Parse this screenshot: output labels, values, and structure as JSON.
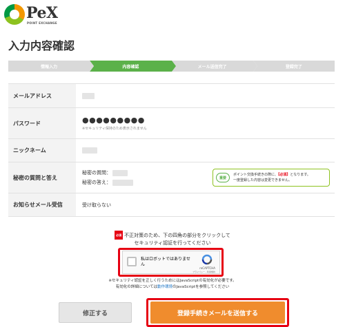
{
  "brand": {
    "logo_text": "PeX",
    "logo_sub": "POINT EXCHANGE"
  },
  "page_title": "入力内容確認",
  "steps": [
    {
      "label": "情報入力",
      "active": false
    },
    {
      "label": "内容確認",
      "active": true
    },
    {
      "label": "メール送信完了",
      "active": false
    },
    {
      "label": "登録完了",
      "active": false
    }
  ],
  "rows": {
    "email": {
      "label": "メールアドレス"
    },
    "password": {
      "label": "パスワード",
      "value": "●●●●●●●●●",
      "note": "※セキュリティ保持のため表示されません"
    },
    "nickname": {
      "label": "ニックネーム"
    },
    "secret": {
      "label": "秘密の質問と答え",
      "question_label": "秘密の質問：",
      "answer_label": "秘密の答え："
    },
    "newsletter": {
      "label": "お知らせメール受信",
      "value": "受け取らない"
    }
  },
  "notice": {
    "badge": "重要",
    "line1_pre": "ポイント交換手続きの際に、",
    "line1_req": "【必須】",
    "line1_post": "となります。",
    "line2": "一度登録した内容は変更できません。"
  },
  "security": {
    "badge": "必須",
    "line1": "不正対策のため、下の四角の部分をクリックして",
    "line2": "セキュリティ認証を行ってください"
  },
  "captcha": {
    "label": "私はロボットではありません",
    "brand": "reCAPTCHA",
    "terms": "プライバシー - 利用規約"
  },
  "js_note": {
    "line1": "※セキュリティ認証を正しく行うためにはJavaScriptの有効化が必要です。",
    "line2_pre": "有効化の詳細については",
    "line2_link": "動作環境",
    "line2_post": "のJavaScriptを参照してください"
  },
  "buttons": {
    "fix": "修正する",
    "send": "登録手続きメールを送信する"
  }
}
